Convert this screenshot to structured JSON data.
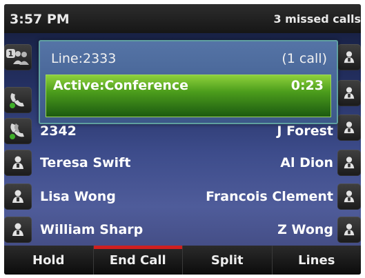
{
  "status": {
    "time": "3:57 PM",
    "missed_calls": "3 missed calls"
  },
  "call": {
    "line": "Line:2333",
    "count": "(1 call)",
    "state": "Active:Conference",
    "timer": "0:23"
  },
  "left_buttons": [
    {
      "icon": "conference-line-icon",
      "badge": "1"
    },
    {
      "icon": "phone-handset-icon"
    },
    {
      "icon": "phone-handset-active-icon"
    },
    {
      "icon": "contact-icon"
    },
    {
      "icon": "contact-icon"
    },
    {
      "icon": "contact-icon"
    }
  ],
  "contacts": {
    "rows": [
      {
        "left": "2342",
        "right": "J Forest"
      },
      {
        "left": "Teresa Swift",
        "right": "Al Dion"
      },
      {
        "left": "Lisa Wong",
        "right": "Francois Clement"
      },
      {
        "left": "William Sharp",
        "right": "Z Wong"
      }
    ]
  },
  "softkeys": [
    {
      "label": "Hold"
    },
    {
      "label": "End Call",
      "accent": "#cf1f1f"
    },
    {
      "label": "Split"
    },
    {
      "label": "Lines"
    }
  ],
  "colors": {
    "active_green": "#4c9d1c",
    "popup_blue": "#4a669a",
    "end_call_red": "#cf1f1f"
  }
}
